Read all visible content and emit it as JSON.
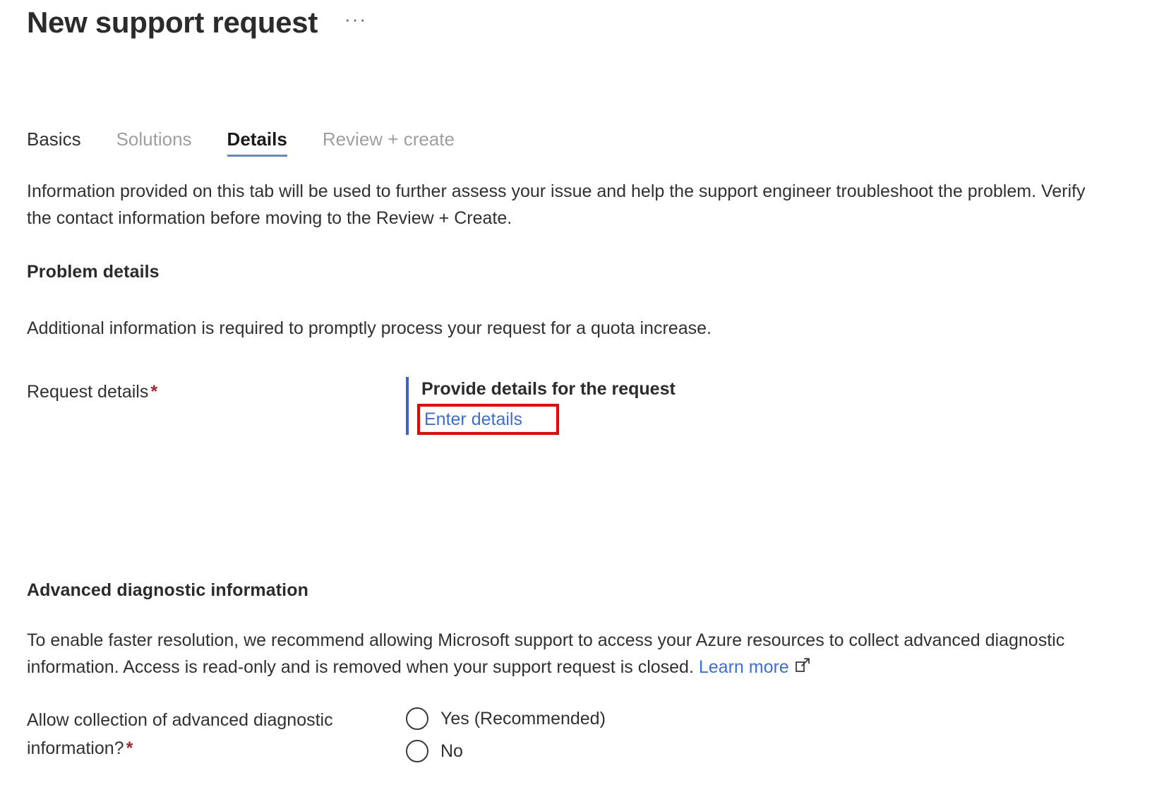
{
  "header": {
    "title": "New support request",
    "more_menu_label": "···",
    "more_menu_name": "ellipsis-icon"
  },
  "tabs": [
    {
      "label": "Basics",
      "state": "visited"
    },
    {
      "label": "Solutions",
      "state": "disabled"
    },
    {
      "label": "Details",
      "state": "active"
    },
    {
      "label": "Review + create",
      "state": "disabled"
    }
  ],
  "main": {
    "intro": "Information provided on this tab will be used to further assess your issue and help the support engineer troubleshoot the problem. Verify the contact information before moving to the Review + Create.",
    "problem_details": {
      "heading": "Problem details",
      "paragraph": "Additional information is required to promptly process your request for a quota increase.",
      "field": {
        "label": "Request details",
        "required_marker": "*",
        "callout_title": "Provide details for the request",
        "link_label": "Enter details"
      }
    },
    "advanced_diagnostics": {
      "heading": "Advanced diagnostic information",
      "paragraph_before_link": "To enable faster resolution, we recommend allowing Microsoft support to access your Azure resources to collect advanced diagnostic information. Access is read-only and is removed when your support request is closed. ",
      "link_label": "Learn more",
      "link_icon": "external-link-icon",
      "question_label": "Allow collection of advanced diagnostic information?",
      "required_marker": "*",
      "options": [
        {
          "label": "Yes (Recommended)",
          "selected": false
        },
        {
          "label": "No",
          "selected": false
        }
      ]
    }
  },
  "colors": {
    "accent_blue": "#3b6fd4",
    "tab_underline": "#5b89d6",
    "callout_bar": "#3b5fd4",
    "highlight_red": "#ef0000",
    "required_red": "#a4262c",
    "text_primary": "#323130",
    "text_disabled": "#a19f9d"
  }
}
